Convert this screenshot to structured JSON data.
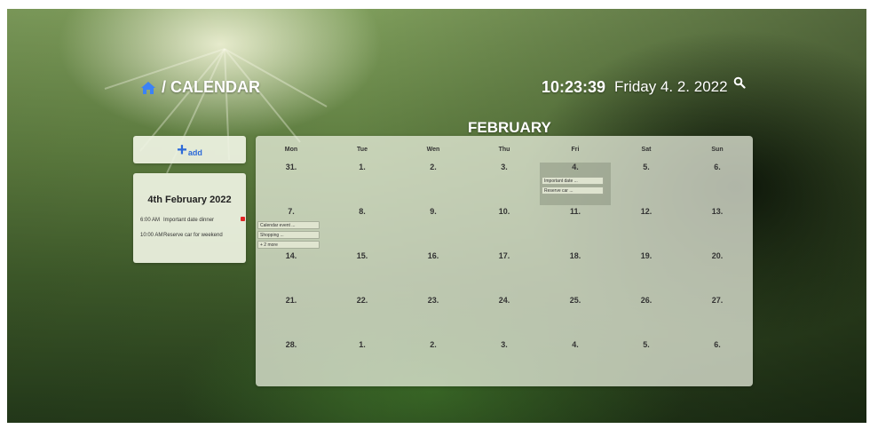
{
  "header": {
    "breadcrumb": "/ CALENDAR",
    "time": "10:23:39",
    "date": "Friday 4. 2. 2022"
  },
  "icons": {
    "home": "home-icon",
    "search": "search-icon",
    "add": "plus-icon",
    "bell": "bell-icon"
  },
  "add_button": {
    "plus": "+",
    "label": "add"
  },
  "month_title": "FEBRUARY",
  "day_panel": {
    "title": "4th February 2022",
    "events": [
      {
        "time": "6:00 AM",
        "name": "Important date dinner"
      },
      {
        "time": "10:00 AM",
        "name": "Reserve car for weekend"
      }
    ]
  },
  "calendar": {
    "weekdays": [
      "Mon",
      "Tue",
      "Wen",
      "Thu",
      "Fri",
      "Sat",
      "Sun"
    ],
    "weeks": [
      [
        "31.",
        "1.",
        "2.",
        "3.",
        "4.",
        "5.",
        "6."
      ],
      [
        "7.",
        "8.",
        "9.",
        "10.",
        "11.",
        "12.",
        "13."
      ],
      [
        "14.",
        "15.",
        "16.",
        "17.",
        "18.",
        "19.",
        "20."
      ],
      [
        "21.",
        "22.",
        "23.",
        "24.",
        "25.",
        "26.",
        "27."
      ],
      [
        "28.",
        "1.",
        "2.",
        "3.",
        "4.",
        "5.",
        "6."
      ]
    ],
    "today": {
      "week": 0,
      "day": 4
    },
    "events": [
      {
        "week": 0,
        "day": 4,
        "items": [
          "Important date ...",
          "Reserve car ..."
        ]
      },
      {
        "week": 1,
        "day": 0,
        "items": [
          "Calendar event ...",
          "Shopping ...",
          "+ 2 more"
        ]
      }
    ]
  },
  "colors": {
    "accent": "#2d6ad8",
    "bell": "#e02424",
    "panel": "#f0f4e4"
  }
}
